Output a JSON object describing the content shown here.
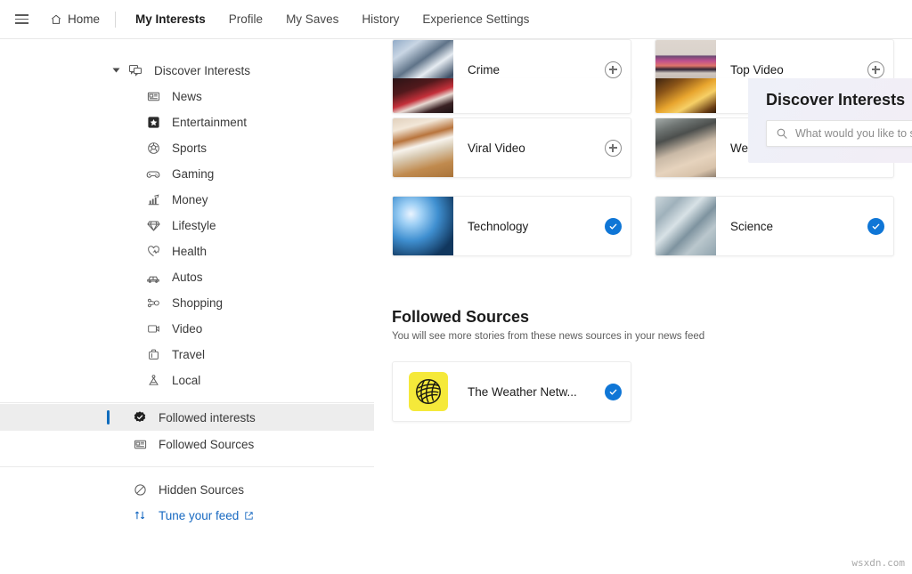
{
  "topnav": {
    "menu_icon": "hamburger-icon",
    "home": "Home",
    "items": [
      {
        "label": "My Interests",
        "active": true
      },
      {
        "label": "Profile",
        "active": false
      },
      {
        "label": "My Saves",
        "active": false
      },
      {
        "label": "History",
        "active": false
      },
      {
        "label": "Experience Settings",
        "active": false
      }
    ]
  },
  "sidebar": {
    "group_title": "Discover Interests",
    "group_icon": "discover-interests-icon",
    "interests": [
      {
        "label": "News",
        "icon": "news-icon"
      },
      {
        "label": "Entertainment",
        "icon": "star-icon"
      },
      {
        "label": "Sports",
        "icon": "sports-ball-icon"
      },
      {
        "label": "Gaming",
        "icon": "gamepad-icon"
      },
      {
        "label": "Money",
        "icon": "chart-growth-icon"
      },
      {
        "label": "Lifestyle",
        "icon": "diamond-icon"
      },
      {
        "label": "Health",
        "icon": "heart-pulse-icon"
      },
      {
        "label": "Autos",
        "icon": "car-icon"
      },
      {
        "label": "Shopping",
        "icon": "shopping-tag-icon"
      },
      {
        "label": "Video",
        "icon": "video-icon"
      },
      {
        "label": "Travel",
        "icon": "suitcase-icon"
      },
      {
        "label": "Local",
        "icon": "location-person-icon"
      }
    ],
    "followed": [
      {
        "label": "Followed interests",
        "icon": "check-badge-icon",
        "selected": true
      },
      {
        "label": "Followed Sources",
        "icon": "news-icon",
        "selected": false
      }
    ],
    "hidden_sources": {
      "label": "Hidden Sources",
      "icon": "block-icon"
    },
    "tune_feed": {
      "label": "Tune your feed",
      "icon": "sort-arrows-icon",
      "external_icon": "external-link-icon"
    }
  },
  "discover": {
    "title": "Discover Interests",
    "search_placeholder": "What would you like to see in your feed?",
    "search_value": "",
    "search_icon": "search-icon"
  },
  "cards": [
    {
      "label": "Crime",
      "followed": false,
      "thumb": "handcuffs-photo",
      "toggle_icon": "plus-circle-icon"
    },
    {
      "label": "Top Video",
      "followed": false,
      "thumb": "television-photo",
      "toggle_icon": "plus-circle-icon"
    },
    {
      "label": "Viral Video",
      "followed": false,
      "thumb": "dog-photo",
      "toggle_icon": "plus-circle-icon"
    },
    {
      "label": "Weather",
      "followed": true,
      "thumb": "tornado-photo",
      "toggle_icon": "check-circle-icon"
    },
    {
      "label": "Technology",
      "followed": true,
      "thumb": "fiber-optics-photo",
      "toggle_icon": "check-circle-icon"
    },
    {
      "label": "Science",
      "followed": true,
      "thumb": "lab-glassware-photo",
      "toggle_icon": "check-circle-icon"
    }
  ],
  "cut_cards": [
    {
      "thumb": "red-lips-photo"
    },
    {
      "thumb": "golden-sunset-photo"
    }
  ],
  "followed_sources": {
    "title": "Followed Sources",
    "subtitle": "You will see more stories from these news sources in your news feed",
    "items": [
      {
        "label": "The Weather Netw...",
        "followed": true,
        "logo": "weather-network-logo",
        "toggle_icon": "check-circle-icon"
      }
    ]
  },
  "watermark": "wsxdn.com",
  "colors": {
    "accent": "#0f76d6",
    "link": "#1668c1",
    "selected_bar": "#0f6cbd"
  }
}
